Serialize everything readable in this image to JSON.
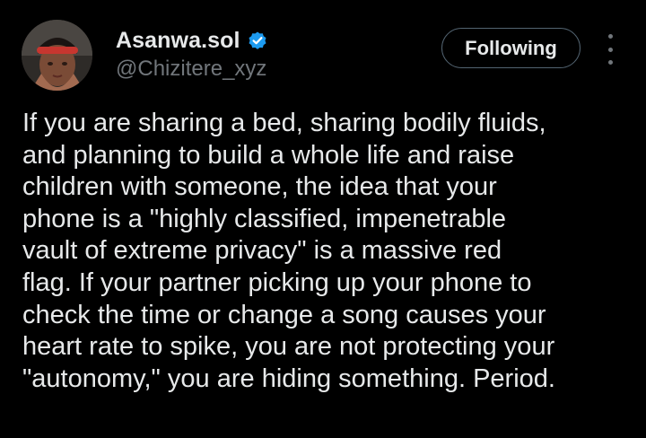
{
  "author": {
    "display_name": "Asanwa.sol",
    "handle": "@Chizitere_xyz",
    "verified": true,
    "avatar_icon": "profile-photo"
  },
  "actions": {
    "follow_label": "Following",
    "more_icon": "ellipsis-vertical-icon"
  },
  "tweet": {
    "lines": [
      "If you are sharing a bed, sharing bodily fluids,",
      "and planning to build a whole life and raise",
      "children with someone, the idea that your",
      "phone is a \"highly classified, impenetrable",
      "vault of extreme privacy\" is a massive red",
      "flag. If your partner picking up your phone to",
      "check the time or change a song causes your",
      "heart rate to spike, you are not protecting your",
      "\"autonomy,\" you are hiding something. Period."
    ]
  },
  "colors": {
    "background": "#000000",
    "text_primary": "#e7e9ea",
    "text_secondary": "#71767b",
    "verified_badge": "#1d9bf0",
    "button_border": "#536471"
  }
}
